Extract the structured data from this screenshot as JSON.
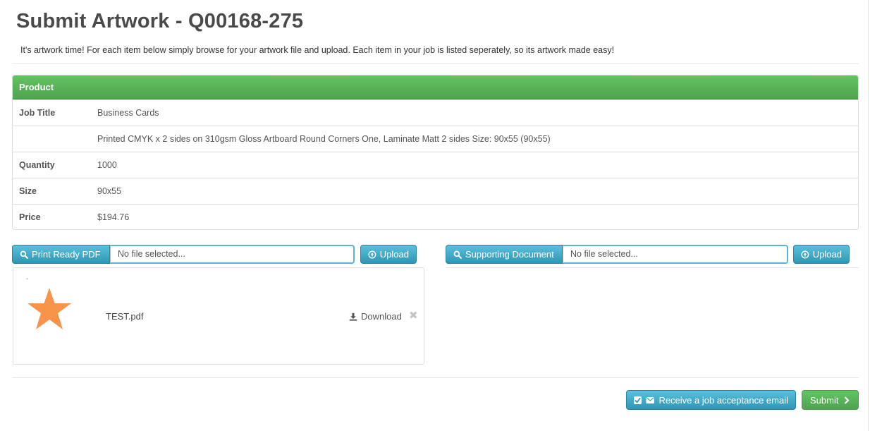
{
  "page": {
    "title": "Submit Artwork - Q00168-275",
    "intro": "It's artwork time! For each item below simply browse for your artwork file and upload. Each item in your job is listed seperately, so its artwork made easy!"
  },
  "product": {
    "header": "Product",
    "rows": [
      {
        "label": "Job Title",
        "value": "Business Cards"
      },
      {
        "label": "",
        "value": "Printed CMYK x 2 sides on 310gsm Gloss Artboard Round Corners One, Laminate Matt 2 sides Size: 90x55 (90x55)"
      },
      {
        "label": "Quantity",
        "value": "1000"
      },
      {
        "label": "Size",
        "value": "90x55"
      },
      {
        "label": "Price",
        "value": "$194.76"
      }
    ]
  },
  "print_pdf": {
    "browse_label": "Print Ready PDF",
    "file_placeholder": "No file selected...",
    "upload_label": "Upload",
    "file": {
      "marker": "-",
      "name": "TEST.pdf",
      "download_label": "Download",
      "remove_glyph": "✖",
      "thumb_icon": "star-icon"
    }
  },
  "supporting_doc": {
    "browse_label": "Supporting Document",
    "file_placeholder": "No file selected...",
    "upload_label": "Upload"
  },
  "footer": {
    "email_label": "Receive a job acceptance email",
    "email_checked": true,
    "submit_label": "Submit"
  },
  "colors": {
    "accent_green": "#5cb85c",
    "accent_blue": "#49afcd",
    "star_orange": "#f7944a"
  }
}
